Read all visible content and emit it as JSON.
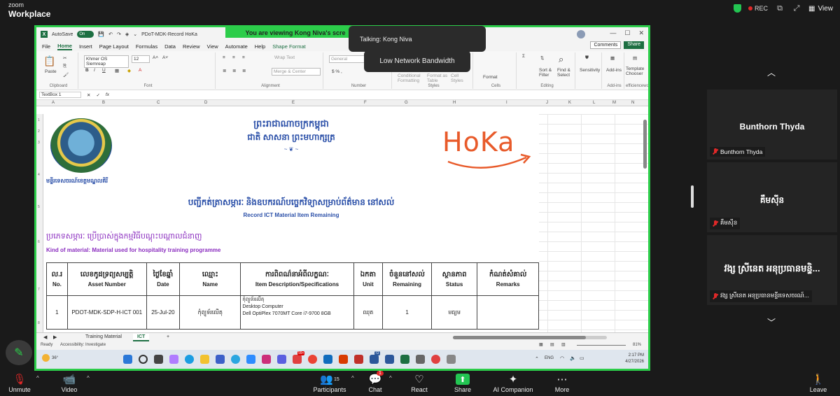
{
  "zoom": {
    "brand_line1": "zoom",
    "brand_line2": "Workplace",
    "rec_label": "REC",
    "view_label": "View",
    "viewing_banner": "You are viewing  Kong Niva's scre",
    "talking": "Talking: Kong Niva",
    "low_bandwidth": "Low Network Bandwidth"
  },
  "excel": {
    "autosave": "AutoSave",
    "toggle": "On",
    "doc_title": "PDoT-MDK-Record HoKa",
    "menu": [
      "File",
      "Home",
      "Insert",
      "Page Layout",
      "Formulas",
      "Data",
      "Review",
      "View",
      "Automate",
      "Help",
      "Shape Format"
    ],
    "comments": "Comments",
    "share": "Share",
    "ribbon": {
      "paste": "Paste",
      "clipboard": "Clipboard",
      "font_name": "Khmer OS Siemreap",
      "font_size": "12",
      "font": "Font",
      "wrap_text": "Wrap Text",
      "merge_center": "Merge & Center",
      "alignment": "Alignment",
      "number_format": "General",
      "number": "Number",
      "cond_format": "Conditional Formatting",
      "format_table": "Format as Table",
      "cell_styles": "Cell Styles",
      "styles": "Styles",
      "format": "Format",
      "cells": "Cells",
      "sort_filter": "Sort & Filter",
      "find_select": "Find & Select",
      "editing": "Editing",
      "sensitivity": "Sensitivity",
      "addins": "Add-ins",
      "addins_group": "Add-ins",
      "template_chooser": "Template Chooser",
      "efficiencework": "efficiencework"
    },
    "name_box": "TextBox 1",
    "fx": "fx",
    "columns": [
      "A",
      "B",
      "C",
      "D",
      "E",
      "F",
      "G",
      "H",
      "I",
      "J",
      "K",
      "L",
      "M",
      "N"
    ],
    "rows": [
      "1",
      "2",
      "3",
      "4",
      "5",
      "6",
      "7",
      "8"
    ],
    "sheet": {
      "kingdom": "ព្រះរាជាណាចក្រកម្ពុជា",
      "motto": "ជាតិ សាសនា ព្រះមហាក្សត្រ",
      "ornament": "~ ❦ ~",
      "ministry": "មន្ទីរទេសចរណ៍ខេត្តមណ្ឌលគិរី",
      "hoka": "HoKa",
      "kh_heading": "បញ្ជីកត់ត្រាសម្ភារៈ និងឧបករណ៍បច្ចេកវិទ្យាសម្រាប់ព័ត៌មាន នៅសល់",
      "en_heading": "Record ICT Material Item Remaining",
      "kind_kh": "ប្រភេទសម្ភារៈ ប្រើប្រាស់ក្នុងកម្មវិធីបណ្តុះបណ្តាលជំនាញ",
      "kind_en": "Kind of material: Material used for hospitality training programme",
      "headers": [
        {
          "kh": "ល.រ",
          "en": "No."
        },
        {
          "kh": "លេខកូដទ្រព្យសម្បត្តិ",
          "en": "Asset Number"
        },
        {
          "kh": "ថ្ងៃខែឆ្នាំ",
          "en": "Date"
        },
        {
          "kh": "ឈ្មោះ",
          "en": "Name"
        },
        {
          "kh": "ការពិពណ៌នាអំពីលក្ខណៈ",
          "en": "Item Description/Specifications"
        },
        {
          "kh": "ឯកតា",
          "en": "Unit"
        },
        {
          "kh": "ចំនួននៅសល់",
          "en": "Remaining"
        },
        {
          "kh": "ស្ថានភាព",
          "en": "Status"
        },
        {
          "kh": "កំណត់សំគាល់",
          "en": "Remarks"
        }
      ],
      "row1": {
        "no": "1",
        "asset": "PDOT-MDK-SDP-H-ICT 001",
        "date": "25-Jul-20",
        "name": "កុំព្យូទ័រលើតុ",
        "desc_kh": "កុំព្យូទ័រលើតុ",
        "desc_l1": "Desktop Computer",
        "desc_l2": "Dell OptiPlex 7070MT Core i7-9700 8GB",
        "unit": "ឈុត",
        "remaining": "1",
        "status": "មធ្យម",
        "remarks": ""
      }
    },
    "tabs": [
      "Training Material",
      "ICT"
    ],
    "status_ready": "Ready",
    "accessibility": "Accessibility: Investigate",
    "zoom_pct": "81%"
  },
  "taskbar": {
    "temp": "36°",
    "lang": "ENG",
    "time": "2:17 PM",
    "date": "4/27/2026",
    "badge1": "72",
    "badge2": "99+"
  },
  "gallery": [
    {
      "big": "Bunthorn Thyda",
      "small": "Bunthorn Thyda"
    },
    {
      "big": "គឹមសុីន",
      "small": "គឹមសុីន"
    },
    {
      "big": "វង្ស ស្រីនេត អនុប្រធានមន្ទិ...",
      "small": "វង្ស ស្រីនេត អនុប្រធានមន្ទីរទេសចរណ៍..."
    }
  ],
  "toolbar": {
    "unmute": "Unmute",
    "video": "Video",
    "participants": "Participants",
    "participants_count": "15",
    "chat": "Chat",
    "chat_badge": "1",
    "react": "React",
    "share": "Share",
    "ai": "AI Companion",
    "more": "More",
    "leave": "Leave"
  },
  "colors": {
    "share_border": "#2ccd4a",
    "excel_green": "#1d6f42",
    "heading_blue": "#2a4fa8",
    "kind_purple": "#8a2cbf",
    "hoka_orange": "#e85a2a",
    "zoom_bg": "#1a1a1a"
  }
}
